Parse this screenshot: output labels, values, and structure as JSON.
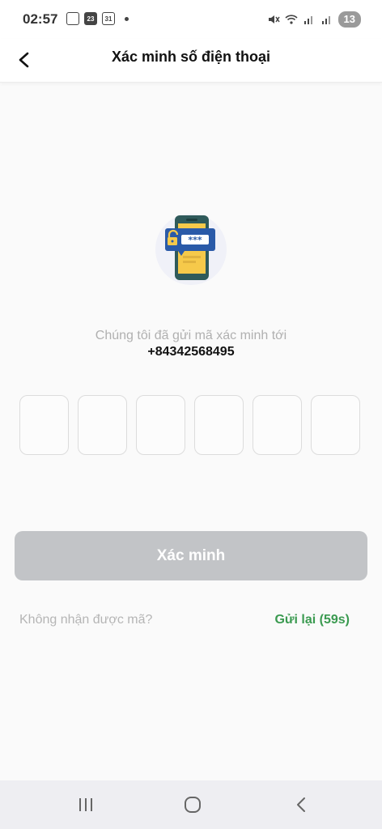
{
  "status_bar": {
    "time": "02:57",
    "mini_icon_1": "",
    "mini_icon_2": "23",
    "mini_icon_3": "31",
    "battery": "13"
  },
  "header": {
    "title": "Xác minh số điện thoại"
  },
  "main": {
    "message": "Chúng tôi đã gửi mã xác minh tới",
    "phone_number": "+84342568495",
    "verify_button": "Xác minh",
    "no_code_text": "Không nhận được mã?",
    "resend_text": "Gửi lại (59s)"
  },
  "colors": {
    "accent_green": "#3a9a50",
    "button_disabled": "#c2c4c7",
    "illustration_blue": "#2a5aa8",
    "illustration_yellow": "#f6c94a",
    "illustration_phone": "#2f5a5a"
  },
  "icons": [
    "back-arrow-icon",
    "lock-icon",
    "mute-icon",
    "wifi-icon",
    "signal-icon",
    "recent-apps-icon",
    "home-icon",
    "nav-back-icon"
  ]
}
